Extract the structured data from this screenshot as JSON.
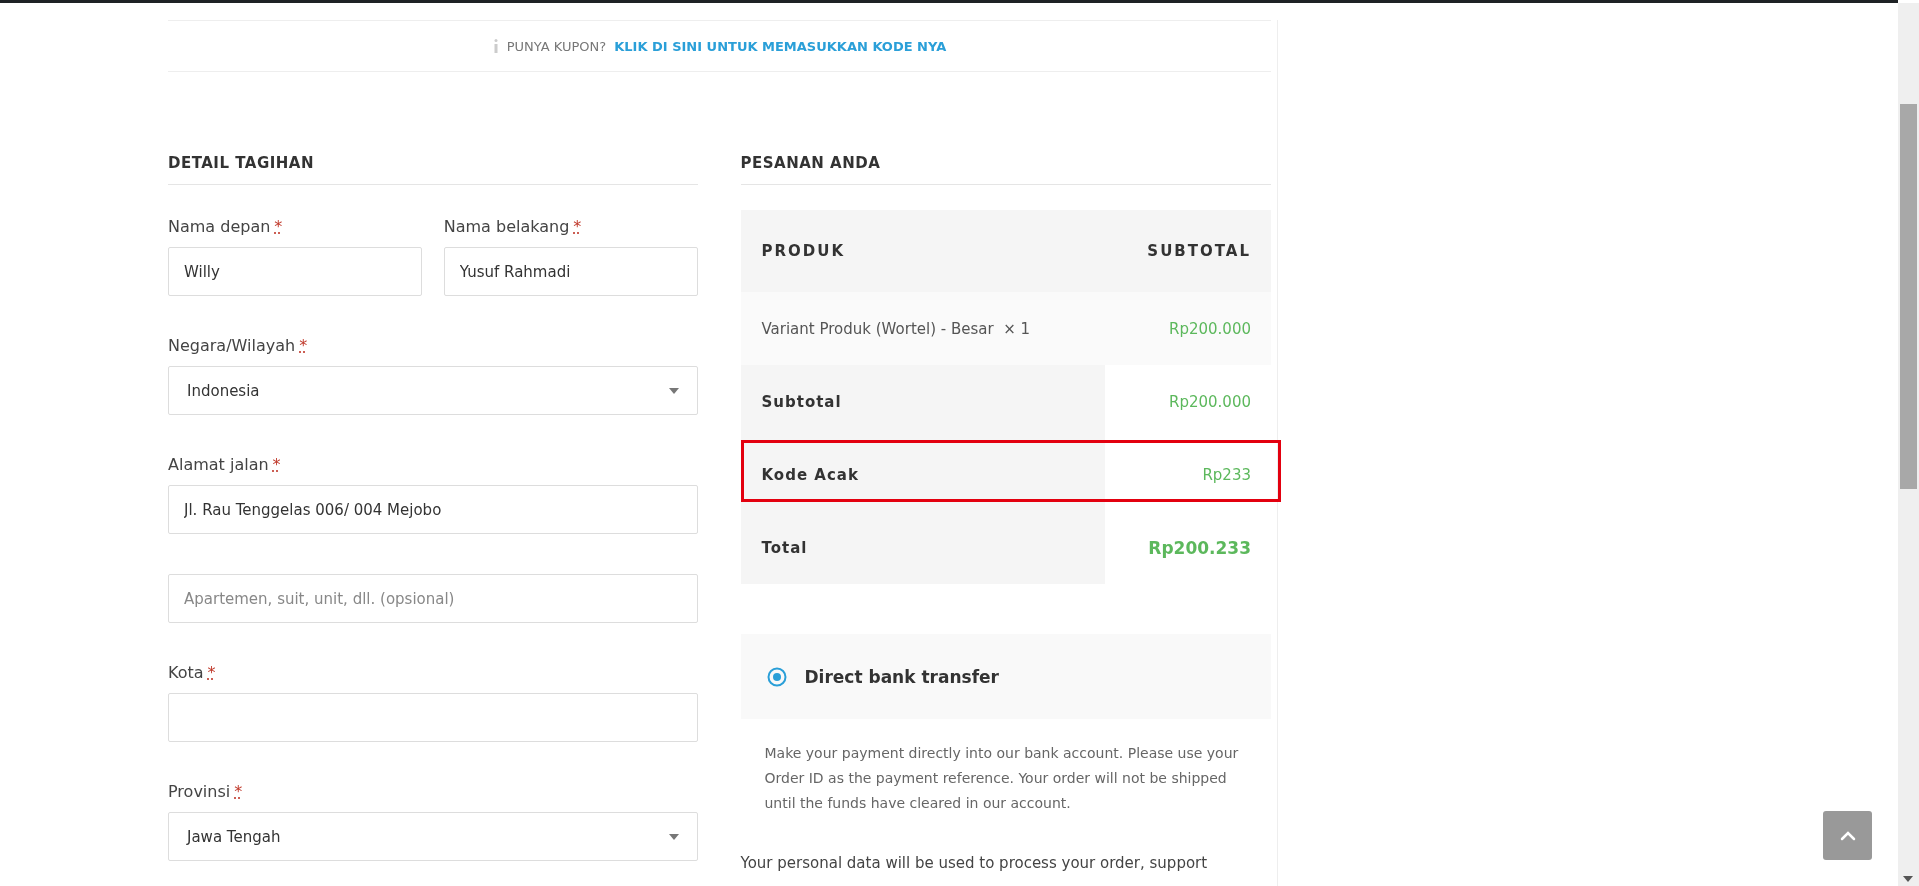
{
  "coupon": {
    "text": "PUNYA KUPON?",
    "link": "KLIK DI SINI UNTUK MEMASUKKAN KODE NYA"
  },
  "billing": {
    "title": "DETAIL TAGIHAN",
    "required_mark": "*",
    "rows": [
      [
        {
          "kind": "text",
          "label": "Nama depan",
          "required": true,
          "value": "Willy"
        },
        {
          "kind": "text",
          "label": "Nama belakang",
          "required": true,
          "value": "Yusuf Rahmadi"
        }
      ],
      [
        {
          "kind": "select",
          "label": "Negara/Wilayah",
          "required": true,
          "value": "Indonesia"
        }
      ],
      [
        {
          "kind": "text",
          "label": "Alamat jalan",
          "required": true,
          "value": "Jl. Rau Tenggelas 006/ 004 Mejobo"
        }
      ],
      [
        {
          "kind": "text",
          "placeholder": "Apartemen, suit, unit, dll. (opsional)",
          "required": false
        }
      ],
      [
        {
          "kind": "text",
          "label": "Kota",
          "required": true
        }
      ],
      [
        {
          "kind": "select",
          "label": "Provinsi",
          "required": true,
          "value": "Jawa Tengah"
        }
      ]
    ]
  },
  "order": {
    "title": "PESANAN ANDA",
    "columns": [
      "PRODUK",
      "SUBTOTAL"
    ],
    "items": [
      {
        "name": "Variant Produk (Wortel) - Besar",
        "qty": "× 1",
        "subtotal": "Rp200.000"
      }
    ],
    "totals": [
      {
        "kind": "line",
        "label": "Subtotal",
        "value": "Rp200.000",
        "highlighted": false
      },
      {
        "kind": "line",
        "label": "Kode Acak",
        "value": "Rp233",
        "highlighted": true
      },
      {
        "kind": "grand",
        "label": "Total",
        "value": "Rp200.233",
        "highlighted": false
      }
    ],
    "payment_methods": [
      {
        "label": "Direct bank transfer",
        "selected": true
      }
    ],
    "payment_description": "Make your payment directly into our bank account. Please use your Order ID as the payment reference. Your order will not be shipped until the funds have cleared in our account.",
    "privacy_text": "Your personal data will be used to process your order, support"
  }
}
